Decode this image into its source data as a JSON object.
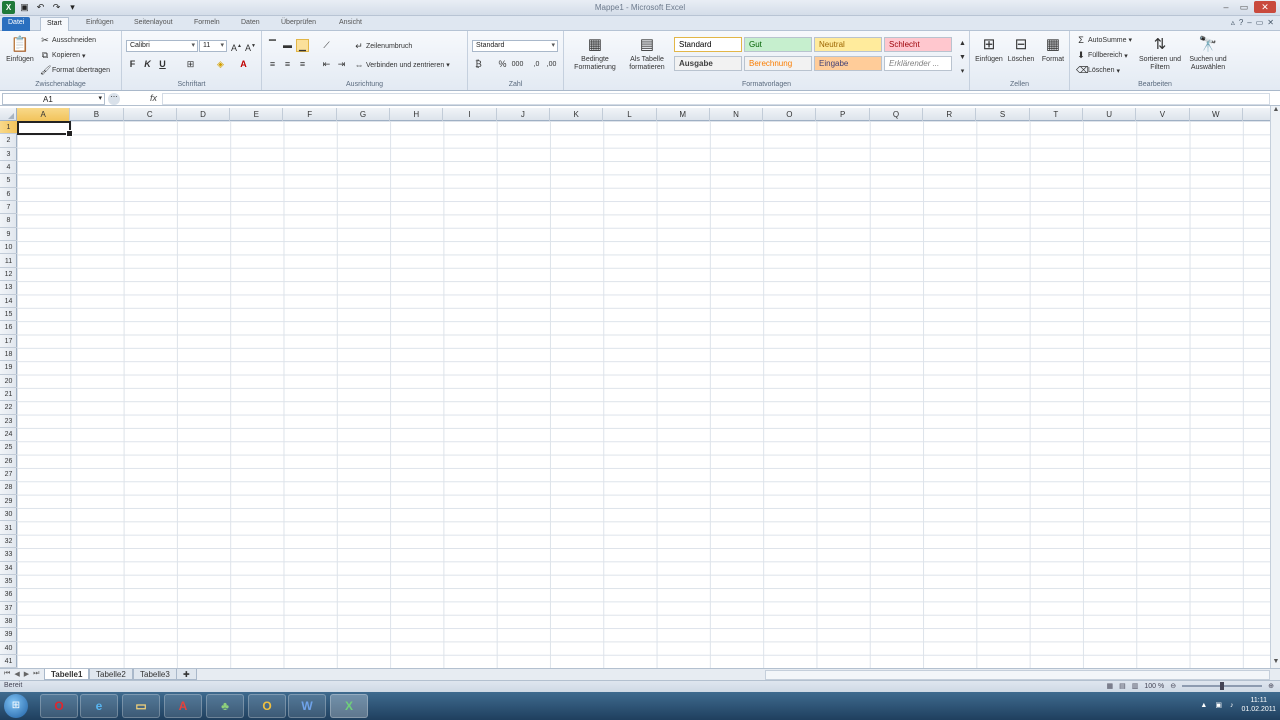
{
  "window": {
    "title": "Mappe1 - Microsoft Excel",
    "app_icon": "X"
  },
  "tabs": [
    "Datei",
    "Start",
    "Einfügen",
    "Seitenlayout",
    "Formeln",
    "Daten",
    "Überprüfen",
    "Ansicht"
  ],
  "ribbon": {
    "clipboard": {
      "label": "Zwischenablage",
      "paste": "Einfügen",
      "cut": "Ausschneiden",
      "copy": "Kopieren",
      "format_painter": "Format übertragen"
    },
    "font": {
      "label": "Schriftart",
      "name": "Calibri",
      "size": "11",
      "bold": "F",
      "italic": "K",
      "underline": "U"
    },
    "alignment": {
      "label": "Ausrichtung",
      "wrap": "Zeilenumbruch",
      "merge": "Verbinden und zentrieren"
    },
    "number": {
      "label": "Zahl",
      "format": "Standard"
    },
    "styles": {
      "label": "Formatvorlagen",
      "conditional": "Bedingte Formatierung",
      "as_table": "Als Tabelle formatieren",
      "items": [
        {
          "name": "Standard",
          "bg": "#ffffff",
          "fg": "#000000"
        },
        {
          "name": "Gut",
          "bg": "#c6efce",
          "fg": "#006100"
        },
        {
          "name": "Neutral",
          "bg": "#ffeb9c",
          "fg": "#9c6500"
        },
        {
          "name": "Schlecht",
          "bg": "#ffc7ce",
          "fg": "#9c0006"
        },
        {
          "name": "Ausgabe",
          "bg": "#f2f2f2",
          "fg": "#3f3f3f"
        },
        {
          "name": "Berechnung",
          "bg": "#f2f2f2",
          "fg": "#fa7d00"
        },
        {
          "name": "Eingabe",
          "bg": "#ffcc99",
          "fg": "#3f3f76"
        },
        {
          "name": "Erklärender ...",
          "bg": "#ffffff",
          "fg": "#7f7f7f"
        }
      ]
    },
    "cells": {
      "label": "Zellen",
      "insert": "Einfügen",
      "delete": "Löschen",
      "format": "Format"
    },
    "editing": {
      "label": "Bearbeiten",
      "autosum": "AutoSumme",
      "fill": "Füllbereich",
      "clear": "Löschen",
      "sort": "Sortieren und Filtern",
      "find": "Suchen und Auswählen"
    }
  },
  "formula_bar": {
    "name_box": "A1",
    "fx": "fx",
    "value": ""
  },
  "grid": {
    "columns": [
      "A",
      "B",
      "C",
      "D",
      "E",
      "F",
      "G",
      "H",
      "I",
      "J",
      "K",
      "L",
      "M",
      "N",
      "O",
      "P",
      "Q",
      "R",
      "S",
      "T",
      "U",
      "V",
      "W"
    ],
    "rows": [
      "1",
      "2",
      "3",
      "4",
      "5",
      "6",
      "7",
      "8",
      "9",
      "10",
      "11",
      "12",
      "13",
      "14",
      "15",
      "16",
      "17",
      "18",
      "19",
      "20",
      "21",
      "22",
      "23",
      "24",
      "25",
      "26",
      "27",
      "28",
      "29",
      "30",
      "31",
      "32",
      "33",
      "34",
      "35",
      "36",
      "37",
      "38",
      "39",
      "40",
      "41"
    ],
    "active_cell": "A1"
  },
  "sheets": [
    "Tabelle1",
    "Tabelle2",
    "Tabelle3"
  ],
  "status": {
    "ready": "Bereit",
    "zoom": "100 %"
  },
  "taskbar": {
    "apps": [
      "opera-icon",
      "ie-icon",
      "explorer-icon",
      "acrobat-icon",
      "game-icon",
      "outlook-icon",
      "word-icon",
      "excel-icon"
    ],
    "time": "11:11",
    "date": "01.02.2011"
  }
}
